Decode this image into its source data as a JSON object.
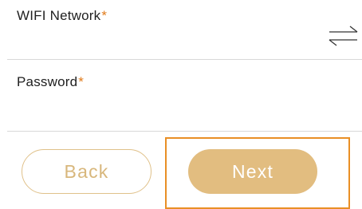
{
  "form": {
    "wifi": {
      "label": "WIFI Network",
      "required_mark": "*",
      "value": "",
      "placeholder": ""
    },
    "password": {
      "label": "Password",
      "required_mark": "*",
      "value": "",
      "placeholder": ""
    },
    "swap_icon": "swap-arrows-icon"
  },
  "actions": {
    "back_label": "Back",
    "next_label": "Next"
  },
  "colors": {
    "accent": "#e2bd80",
    "required": "#e07a1a",
    "focus": "#e98f25",
    "divider": "#d8d8d8"
  }
}
